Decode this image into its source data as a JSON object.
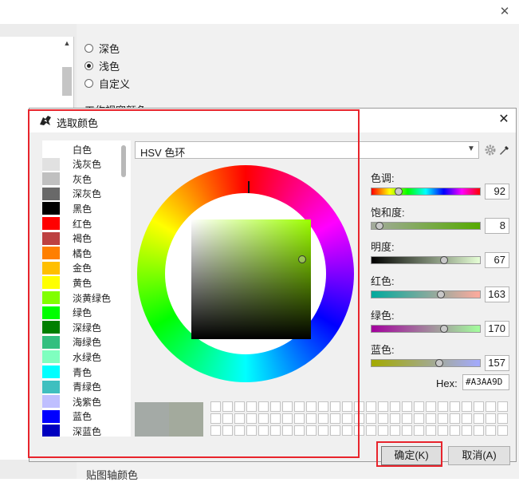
{
  "background_window": {
    "radio_options": [
      {
        "label": "深色",
        "selected": false
      },
      {
        "label": "浅色",
        "selected": true
      },
      {
        "label": "自定义",
        "selected": false
      }
    ],
    "partial_label_top": "工作视窗颜色",
    "partial_label_bottom": "贴图轴颜色"
  },
  "dialog": {
    "title": "选取颜色",
    "color_list": [
      {
        "name": "白色",
        "color": "#FFFFFF"
      },
      {
        "name": "浅灰色",
        "color": "#E1E1E1"
      },
      {
        "name": "灰色",
        "color": "#C0C0C0"
      },
      {
        "name": "深灰色",
        "color": "#696969"
      },
      {
        "name": "黑色",
        "color": "#000000"
      },
      {
        "name": "红色",
        "color": "#FF0000"
      },
      {
        "name": "褐色",
        "color": "#BD4141"
      },
      {
        "name": "橘色",
        "color": "#FF7F00"
      },
      {
        "name": "金色",
        "color": "#FFBF00"
      },
      {
        "name": "黄色",
        "color": "#FFFF00"
      },
      {
        "name": "淡黄绿色",
        "color": "#80FF00"
      },
      {
        "name": "绿色",
        "color": "#00FF00"
      },
      {
        "name": "深绿色",
        "color": "#007F00"
      },
      {
        "name": "海绿色",
        "color": "#33BF7F"
      },
      {
        "name": "水绿色",
        "color": "#7FFFBF"
      },
      {
        "name": "青色",
        "color": "#00FFFF"
      },
      {
        "name": "青绿色",
        "color": "#3FBFBF"
      },
      {
        "name": "浅紫色",
        "color": "#BFBFFF"
      },
      {
        "name": "蓝色",
        "color": "#0000FF"
      },
      {
        "name": "深蓝色",
        "color": "#0000BF"
      }
    ],
    "mode": "HSV 色环",
    "sliders": [
      {
        "label": "色调:",
        "value": "92",
        "fraction": 0.256
      },
      {
        "label": "饱和度:",
        "value": "8",
        "fraction": 0.08
      },
      {
        "label": "明度:",
        "value": "67",
        "fraction": 0.67
      },
      {
        "label": "红色:",
        "value": "163",
        "fraction": 0.64
      },
      {
        "label": "绿色:",
        "value": "170",
        "fraction": 0.67
      },
      {
        "label": "蓝色:",
        "value": "157",
        "fraction": 0.62
      }
    ],
    "hex_label": "Hex:",
    "hex_value": "#A3AA9D",
    "preview_old_color": "#A4AAA6",
    "preview_new_color": "#A3AA9D",
    "ok_label": "确定(K)",
    "cancel_label": "取消(A)"
  },
  "colors": {
    "annotation_red": "#E8242C"
  }
}
